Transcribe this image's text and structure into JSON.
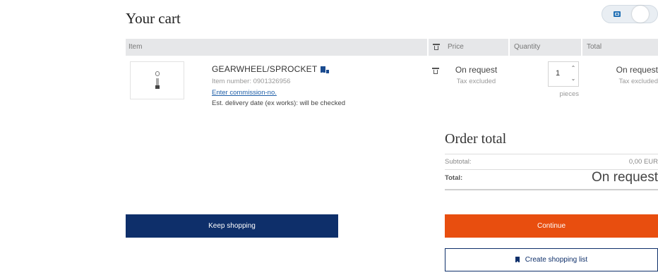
{
  "page": {
    "title": "Your cart"
  },
  "toggle": {
    "icon": "grid-view-icon"
  },
  "table": {
    "headers": {
      "item": "Item",
      "price": "Price",
      "quantity": "Quantity",
      "total": "Total"
    },
    "rows": [
      {
        "name": "GEARWHEEL/SPROCKET",
        "item_number": "Item number: 0901326956",
        "commission_link": "Enter commission-no.",
        "delivery": "Est. delivery date (ex works): will be checked",
        "price": "On request",
        "price_tax": "Tax excluded",
        "quantity": "1",
        "unit": "pieces",
        "total": "On request",
        "total_tax": "Tax excluded"
      }
    ]
  },
  "order": {
    "title": "Order total",
    "subtotal_label": "Subtotal:",
    "subtotal_value": "0,00 EUR",
    "total_label": "Total:",
    "total_value": "On request"
  },
  "buttons": {
    "keep_shopping": "Keep shopping",
    "continue": "Continue",
    "create_list": "Create shopping list"
  },
  "colors": {
    "primary": "#0e2f6a",
    "accent": "#e84e0f",
    "link": "#1f5fa8"
  }
}
